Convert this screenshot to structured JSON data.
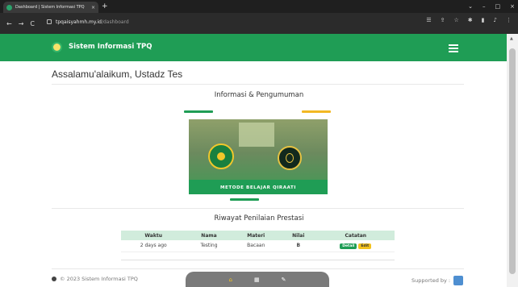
{
  "browser": {
    "tab_title": "Dashboard | Sistem Informasi TPQ",
    "tab_close": "×",
    "new_tab": "+",
    "url_host": "tpqaisyahmh.my.id",
    "url_path": "/dashboard",
    "back": "←",
    "forward": "→",
    "reload": "C",
    "window_controls": [
      "⌄",
      "–",
      "□",
      "×"
    ],
    "extensions": [
      "☰",
      "⇪",
      "☆",
      "✱",
      "▮",
      "♪",
      "⋮"
    ]
  },
  "header": {
    "brand_name": "Sistem Informasi TPQ",
    "menu_icon": "hamburger-icon",
    "bg_color": "#1f9d55"
  },
  "main": {
    "greeting": "Assalamu'alaikum, Ustadz Tes",
    "info_title": "Informasi & Pengumuman",
    "banner_caption": "METODE BELAJAR QIRAATI",
    "riwayat_title": "Riwayat Penilaian Prestasi",
    "table": {
      "headers": [
        "Waktu",
        "Nama",
        "Materi",
        "Nilai",
        "Catatan"
      ],
      "rows": [
        {
          "waktu": "2 days ago",
          "nama": "Testing",
          "materi": "Bacaan",
          "nilai": "B",
          "detail": "Detail",
          "edit": "Edit"
        }
      ]
    }
  },
  "footer": {
    "copyright": "© 2023 Sistem Informasi TPQ",
    "supported_by": "Supported by :",
    "nav_icons": [
      "home-icon",
      "dashboard-icon",
      "edit-icon"
    ],
    "nav_glyphs": [
      "⌂",
      "▦",
      "✎"
    ]
  },
  "colors": {
    "accent_green": "#1f9d55",
    "accent_yellow": "#f2b824"
  }
}
